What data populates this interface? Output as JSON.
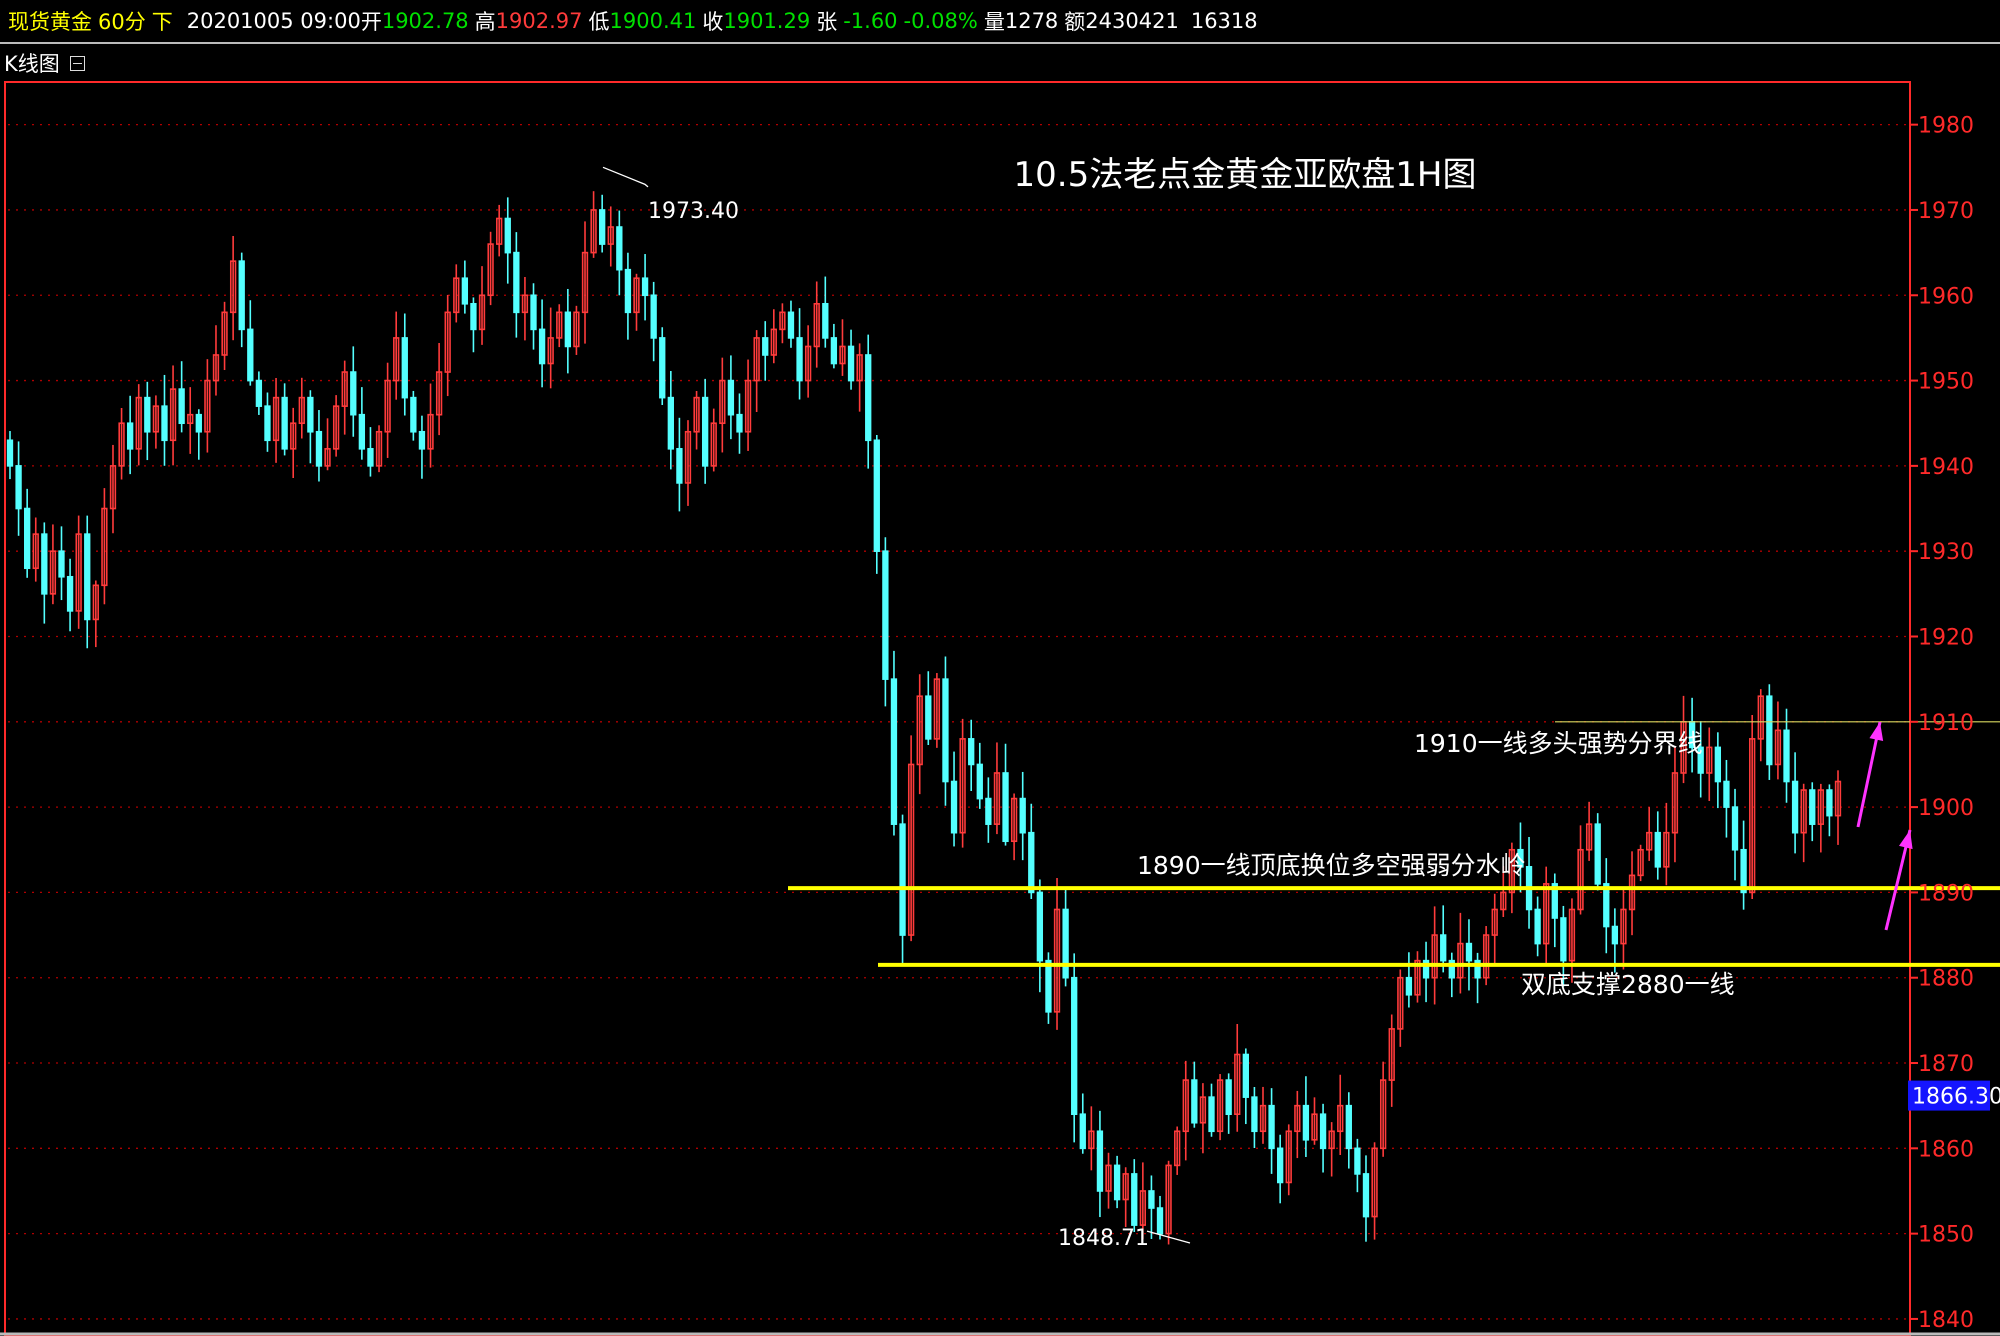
{
  "header": {
    "symbol": "现货黄金",
    "period": "60分",
    "direction_label": "下",
    "datetime": "20201005 09:00",
    "open_label": "开",
    "open": "1902.78",
    "high_label": "高",
    "high": "1902.97",
    "low_label": "低",
    "low": "1900.41",
    "close_label": "收",
    "close": "1901.29",
    "change_label": "张",
    "change": "-1.60",
    "change_pct": "-0.08%",
    "volume_label": "量",
    "volume": "1278",
    "amount_label": "额",
    "amount": "2430421",
    "extra": "16318"
  },
  "subheader": {
    "title": "K线图",
    "icon": "minimize-box-icon"
  },
  "colors": {
    "up": "#ff3b3b",
    "down": "#54ffff",
    "axis": "#ff2a2a",
    "grid": "#b00000",
    "support": "#ffff00",
    "arrow": "#ff33ff",
    "current_price_bg": "#1515ff",
    "label": "#ffffff",
    "header_yellow": "#ffff00",
    "header_green": "#00e000"
  },
  "chart_data": {
    "type": "candlestick",
    "title": "10.5法老点金黄金亚欧盘1H图",
    "ylim": [
      1838,
      1985
    ],
    "yticks": [
      1840,
      1850,
      1860,
      1870,
      1880,
      1890,
      1900,
      1910,
      1920,
      1930,
      1940,
      1950,
      1960,
      1970,
      1980
    ],
    "grid": true,
    "current_price": "1866.30",
    "closes": [
      1940,
      1935,
      1928,
      1932,
      1925,
      1930,
      1927,
      1923,
      1932,
      1922,
      1926,
      1935,
      1940,
      1945,
      1942,
      1948,
      1944,
      1947,
      1943,
      1949,
      1945,
      1946,
      1944,
      1950,
      1953,
      1958,
      1964,
      1956,
      1950,
      1947,
      1943,
      1948,
      1942,
      1945,
      1948,
      1944,
      1940,
      1942,
      1947,
      1951,
      1946,
      1942,
      1940,
      1944,
      1950,
      1955,
      1948,
      1944,
      1942,
      1946,
      1951,
      1958,
      1962,
      1959,
      1956,
      1960,
      1966,
      1969,
      1965,
      1958,
      1960,
      1956,
      1952,
      1955,
      1958,
      1954,
      1958,
      1965,
      1970,
      1966,
      1968,
      1963,
      1958,
      1962,
      1960,
      1955,
      1948,
      1942,
      1938,
      1944,
      1948,
      1940,
      1945,
      1950,
      1946,
      1944,
      1950,
      1955,
      1953,
      1956,
      1958,
      1955,
      1950,
      1954,
      1959,
      1955,
      1952,
      1954,
      1950,
      1953,
      1943,
      1930,
      1915,
      1898,
      1885,
      1905,
      1913,
      1908,
      1915,
      1903,
      1897,
      1908,
      1905,
      1901,
      1898,
      1904,
      1896,
      1901,
      1897,
      1890,
      1882,
      1876,
      1888,
      1880,
      1864,
      1860,
      1862,
      1855,
      1858,
      1854,
      1857,
      1851,
      1855,
      1853,
      1850,
      1858,
      1862,
      1868,
      1863,
      1866,
      1862,
      1868,
      1864,
      1871,
      1866,
      1862,
      1865,
      1860,
      1856,
      1862,
      1865,
      1861,
      1864,
      1860,
      1862,
      1865,
      1860,
      1857,
      1852,
      1860,
      1868,
      1874,
      1880,
      1878,
      1882,
      1880,
      1885,
      1882,
      1880,
      1884,
      1882,
      1880,
      1885,
      1888,
      1890,
      1895,
      1893,
      1888,
      1884,
      1891,
      1887,
      1882,
      1888,
      1895,
      1898,
      1891,
      1886,
      1884,
      1888,
      1892,
      1895,
      1897,
      1893,
      1897,
      1904,
      1910,
      1907,
      1904,
      1907,
      1903,
      1900,
      1895,
      1890,
      1908,
      1913,
      1905,
      1909,
      1903,
      1897,
      1902,
      1898,
      1902,
      1899,
      1903
    ],
    "annotations": [
      {
        "text": "1973.40",
        "price": 1973.4
      },
      {
        "text": "1848.71",
        "price": 1848.71
      },
      {
        "text": "1910一线多头强势分界线",
        "price": 1910
      },
      {
        "text": "1890一线顶底换位多空强弱分水岭",
        "price": 1890
      },
      {
        "text": "双底支撑2880一线",
        "price": 1881.5
      }
    ],
    "hlines": [
      {
        "price": 1890.5,
        "style": "solid-yellow"
      },
      {
        "price": 1881.5,
        "style": "solid-yellow"
      },
      {
        "price": 1910,
        "style": "thin-yellow"
      }
    ],
    "arrows": [
      "up",
      "up"
    ]
  }
}
